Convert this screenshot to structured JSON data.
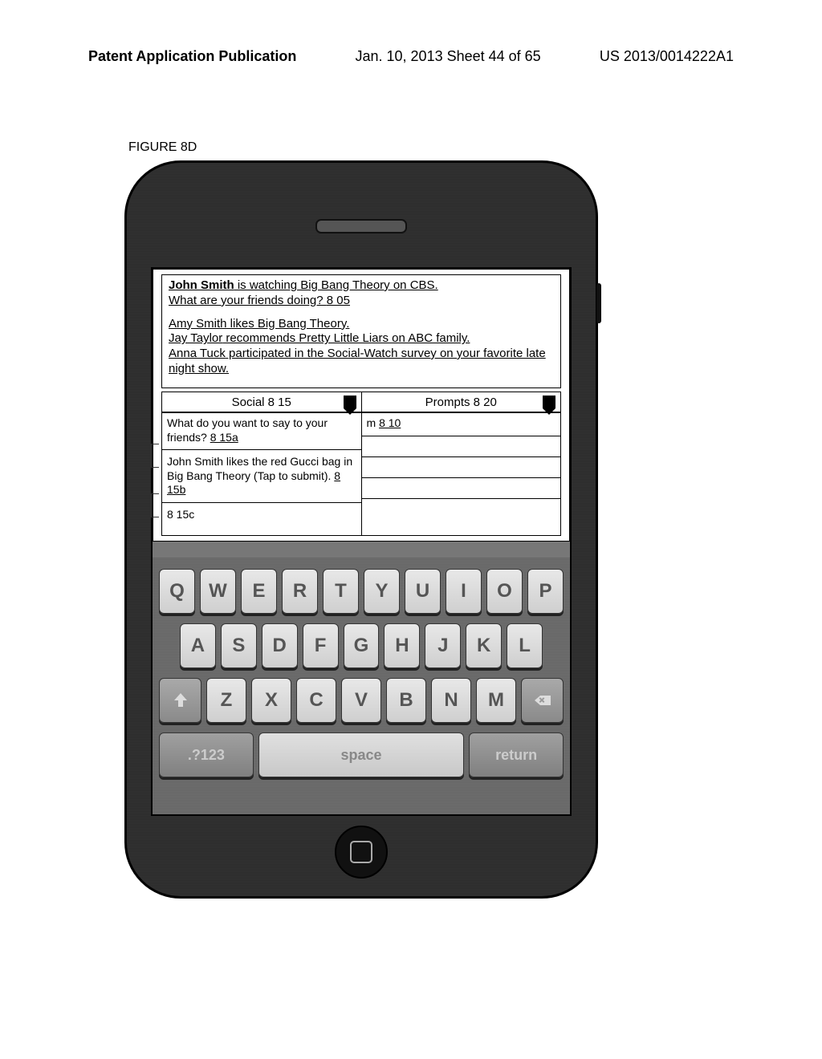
{
  "header": {
    "left": "Patent Application Publication",
    "center": "Jan. 10, 2013  Sheet 44 of 65",
    "right": "US 2013/0014222A1"
  },
  "figure_label": "FIGURE 8D",
  "feed": {
    "line1_name": "John Smith",
    "line1_rest": " is watching Big Bang Theory on CBS.",
    "line2_text": "What are your friends doing?  ",
    "line2_ref": "8 05",
    "line3_name": "Amy Smith",
    "line3_rest": " likes Big Bang Theory.",
    "line4_name": "Jay Taylor",
    "line4_rest": " recommends Pretty Little Liars on ABC family.",
    "line5_name": "Anna Tuck",
    "line5_rest": " participated in the Social-Watch  survey on your favorite late night show."
  },
  "dropdowns": {
    "left": "Social 8 15",
    "right": "Prompts 8 20"
  },
  "social_col": {
    "q": "What do you want to say to your friends? ",
    "q_ref": "8 15a",
    "entry": "John Smith likes the red Gucci bag in Big Bang Theory (Tap to submit).  ",
    "entry_ref": "8 15b",
    "input_ref": "8 15c"
  },
  "prompts_col": {
    "top_label": "m ",
    "top_ref": "8 10"
  },
  "keyboard": {
    "row1": [
      "Q",
      "W",
      "E",
      "R",
      "T",
      "Y",
      "U",
      "I",
      "O",
      "P"
    ],
    "row2": [
      "A",
      "S",
      "D",
      "F",
      "G",
      "H",
      "J",
      "K",
      "L"
    ],
    "row3": [
      "Z",
      "X",
      "C",
      "V",
      "B",
      "N",
      "M"
    ],
    "num_label": ".?123",
    "space_label": "space",
    "return_label": "return"
  }
}
